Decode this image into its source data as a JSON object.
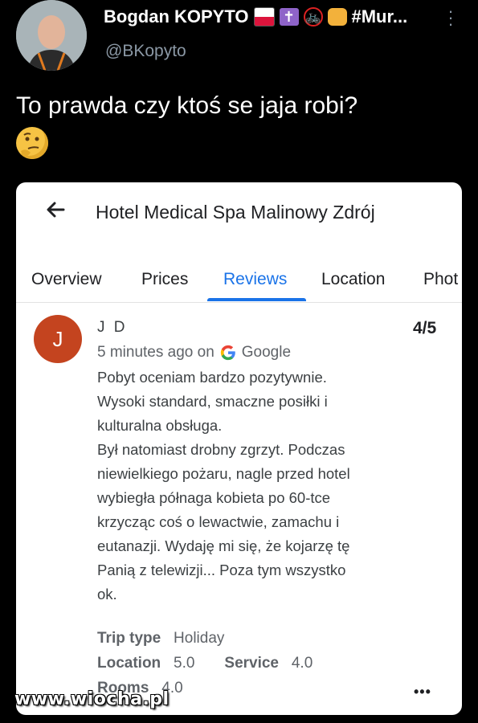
{
  "tweet": {
    "display_name": "Bogdan KOPYTO",
    "name_suffix": "#Mur...",
    "name_emojis": [
      "flag-poland-icon",
      "latin-cross-icon",
      "no-bicycles-icon",
      "fist-icon"
    ],
    "handle": "@BKopyto",
    "text": "To prawda czy ktoś se jaja robi?",
    "emoji": "thinking-face-icon"
  },
  "card": {
    "hotel_title": "Hotel Medical Spa Malinowy Zdrój",
    "tabs": [
      "Overview",
      "Prices",
      "Reviews",
      "Location",
      "Phot"
    ],
    "active_tab": "Reviews",
    "accent_color": "#1a73e8",
    "review": {
      "avatar_letter": "J",
      "avatar_color": "#c4441f",
      "reviewer": "J D",
      "rating": "4/5",
      "time_ago": "5 minutes ago on",
      "source": "Google",
      "body": [
        "Pobyt oceniam bardzo pozytywnie.",
        "Wysoki standard, smaczne posiłki i",
        "kulturalna obsługa.",
        "Był natomiast drobny zgrzyt. Podczas",
        "niewielkiego pożaru, nagle przed hotel",
        "wybiegła półnaga kobieta po 60-tce",
        "krzycząc coś o lewactwie, zamachu i",
        "eutanazji. Wydaję mi się, że kojarzę tę",
        "Panią z telewizji... Poza tym wszystko",
        "ok."
      ],
      "trip_type_label": "Trip type",
      "trip_type_value": "Holiday",
      "location_label": "Location",
      "location_value": "5.0",
      "service_label": "Service",
      "service_value": "4.0",
      "rooms_label": "Rooms",
      "rooms_value": "4.0"
    }
  },
  "watermark": "www.wiocha.pl"
}
